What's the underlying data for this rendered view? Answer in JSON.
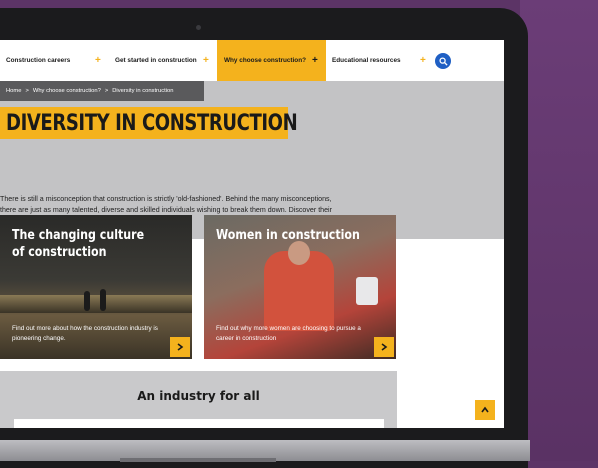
{
  "nav": {
    "items": [
      {
        "label": "Construction careers"
      },
      {
        "label": "Get started in construction"
      },
      {
        "label": "Why choose construction?"
      },
      {
        "label": "Educational resources"
      }
    ],
    "plus_glyph": "+",
    "search_icon": "search-icon"
  },
  "breadcrumb": {
    "home": "Home",
    "sep": ">",
    "parent": "Why choose construction?",
    "current": "Diversity in construction"
  },
  "hero": {
    "title": "DIVERSITY IN CONSTRUCTION",
    "intro": "There is still a misconception that construction is strictly 'old-fashioned'. Behind the many misconceptions, there are just as many talented, diverse and skilled individuals wishing to break them down. Discover their stories and how you can make a difference."
  },
  "cards": [
    {
      "title": "The changing culture of construction",
      "text": "Find out more about how the construction industry is pioneering change."
    },
    {
      "title": "Women in construction",
      "text": "Find out why more women are choosing to pursue a career in construction"
    }
  ],
  "industry": {
    "title": "An industry for all"
  },
  "colors": {
    "accent": "#f4b21d",
    "search": "#1f5fc4",
    "background": "#5c3466"
  }
}
